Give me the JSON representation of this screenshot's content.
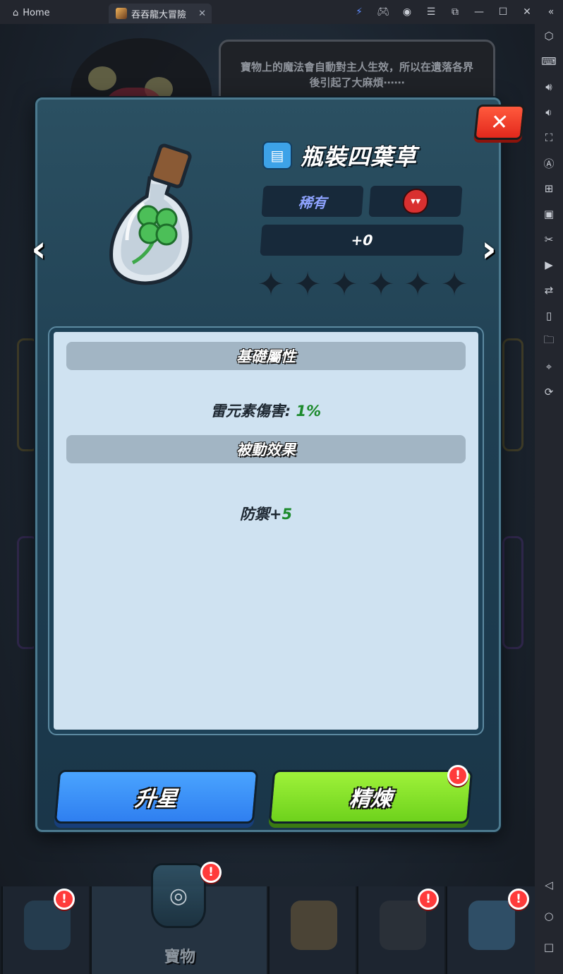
{
  "tabs": [
    {
      "label": "Home"
    },
    {
      "label": "吞吞龍大冒險"
    }
  ],
  "tooltip": {
    "text": "寶物上的魔法會自動對主人生效，所以在遺落各界後引起了大麻煩⋯⋯"
  },
  "item": {
    "name": "瓶裝四葉草",
    "rarity": "稀有",
    "level": "+0",
    "stars_filled": 0,
    "stars_total": 6
  },
  "panel": {
    "base_header": "基礎屬性",
    "base_stat_label": "雷元素傷害:",
    "base_stat_value": "1%",
    "passive_header": "被動效果",
    "passive_label": "防禦+",
    "passive_value": "5"
  },
  "buttons": {
    "upgrade": "升星",
    "refine": "精煉",
    "refine_badge": "!"
  },
  "bottom_nav": {
    "active_label": "寶物",
    "badge": "!"
  },
  "colors": {
    "accent_blue": "#3d8cff",
    "accent_green": "#7ee02a",
    "close_red": "#e8321f",
    "rarity": "#8ea3ff",
    "stat_value": "#1c8a2c"
  }
}
